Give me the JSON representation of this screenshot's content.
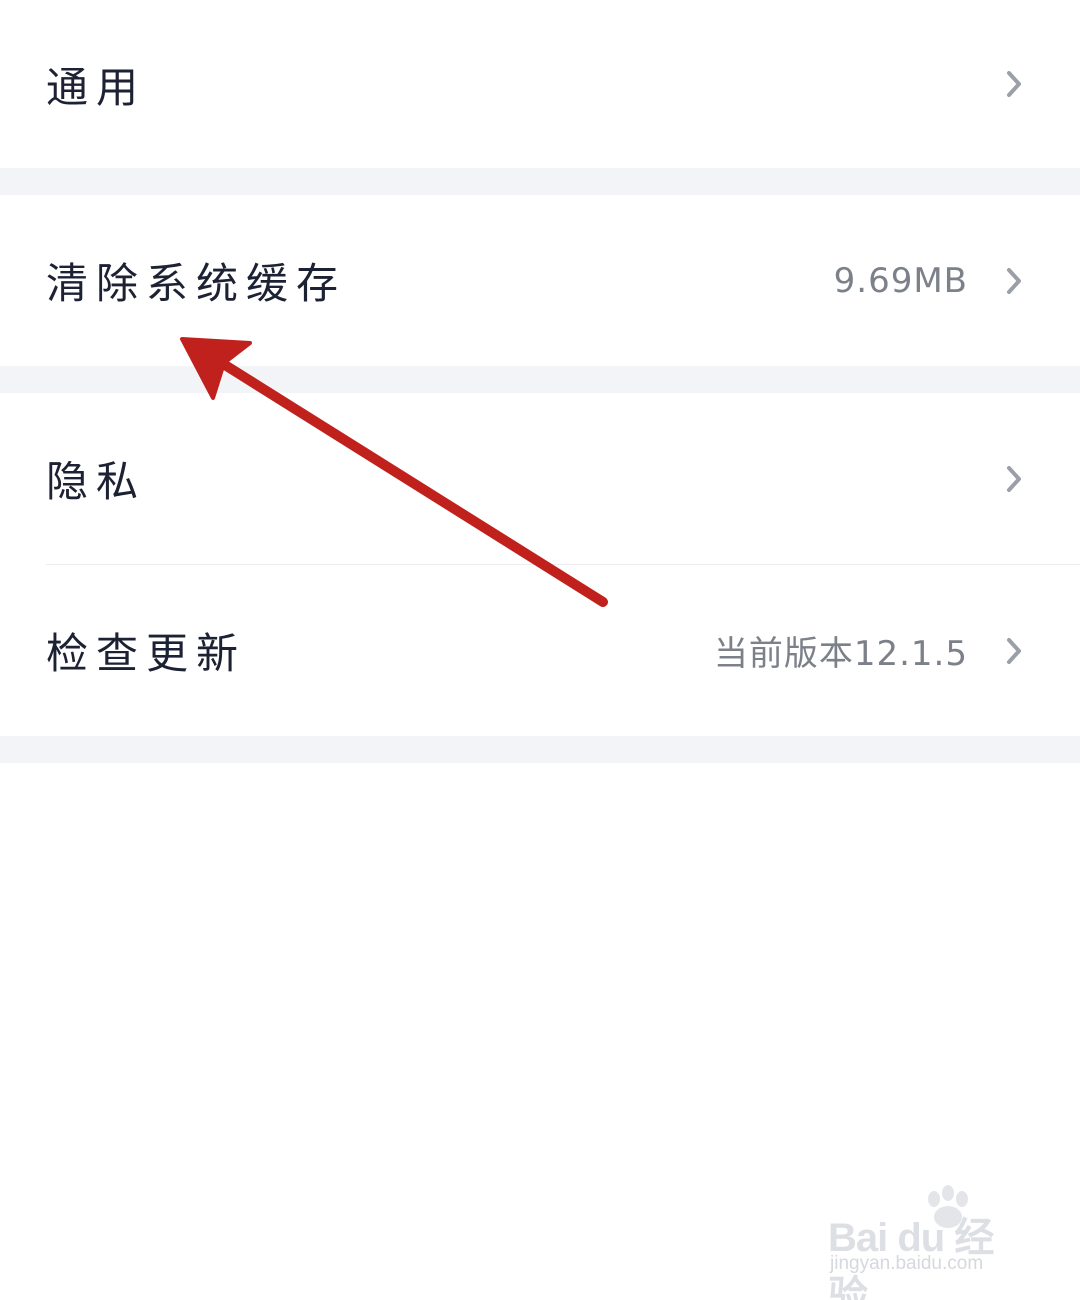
{
  "settings": {
    "rows": [
      {
        "label": "通用",
        "value": ""
      },
      {
        "label": "清除系统缓存",
        "value": "9.69MB"
      },
      {
        "label": "隐私",
        "value": ""
      },
      {
        "label": "检查更新",
        "value": "当前版本12.1.5"
      }
    ]
  },
  "icons": {
    "chevron": "chevron-right-icon",
    "annotation": "red-arrow-annotation"
  },
  "colors": {
    "background": "#ffffff",
    "section_gap": "#f2f4f8",
    "label_text": "#1c2233",
    "value_text": "#7b8089",
    "chevron": "#9a9fa8",
    "arrow": "#c0211c"
  },
  "watermark": {
    "logo_text": "Bai du 经验",
    "url_text": "jingyan.baidu.com"
  }
}
